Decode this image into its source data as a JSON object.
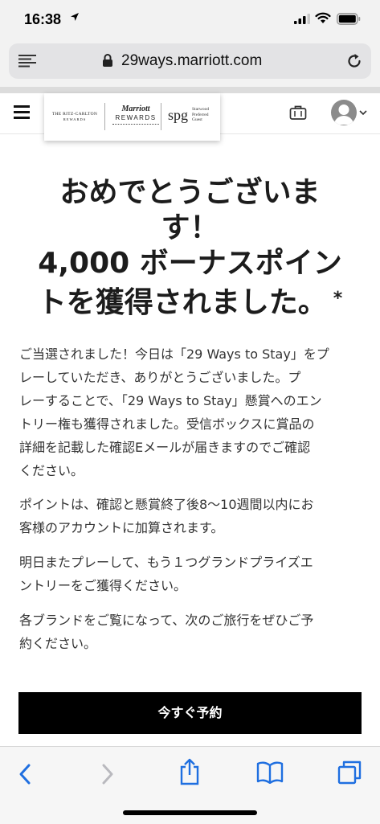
{
  "status_bar": {
    "time": "16:38"
  },
  "browser": {
    "url": "29ways.marriott.com"
  },
  "header": {
    "logos": {
      "ritz_line1": "THE RITZ-CARLTON",
      "ritz_line2": "REWARDS",
      "marriott_line1": "Marriott",
      "marriott_line2": "REWARDS",
      "spg": "spg",
      "spg_sub1": "Starwood",
      "spg_sub2": "Preferred",
      "spg_sub3": "Guest"
    }
  },
  "content": {
    "headline_lines": [
      "おめでとうございま",
      "す！",
      "4,000 ボーナスポイン",
      "トを獲得されました。"
    ],
    "headline_asterisk": "*",
    "paragraph1_lines": [
      "ご当選されました！今日は「29 Ways to Stay」をプ",
      "レーしていただき、ありがとうございました。プ",
      "レーすることで、「29 Ways to Stay」懸賞へのエン",
      "トリー権も獲得されました。受信ボックスに賞品の",
      "詳細を記載した確認Eメールが届きますのでご確認",
      "ください。"
    ],
    "paragraph2_lines": [
      "ポイントは、確認と懸賞終了後8〜10週間以内にお",
      "客様のアカウントに加算されます。"
    ],
    "paragraph3_lines": [
      "明日またプレーして、もう１つグランドプライズエ",
      "ントリーをご獲得ください。"
    ],
    "paragraph4_lines": [
      "各ブランドをご覧になって、次のご旅行をぜひご予",
      "約ください。"
    ],
    "book_button_label": "今すぐ予約"
  },
  "colors": {
    "safari_blue": "#1f6fe0",
    "button_bg": "#000000",
    "text": "#1c1c1c"
  }
}
